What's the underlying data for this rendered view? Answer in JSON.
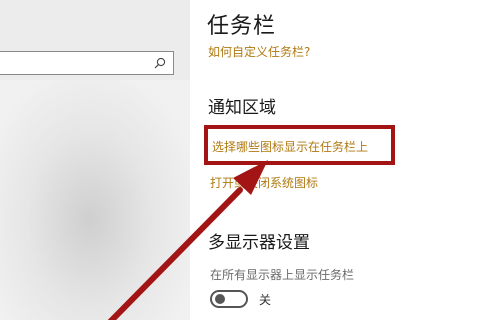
{
  "window": {
    "page_title": "任务栏"
  },
  "sidebar": {
    "search": {
      "placeholder": "",
      "icon": "search-icon"
    }
  },
  "main": {
    "help_link": "如何自定义任务栏?",
    "notification_area": {
      "title": "通知区域",
      "select_icons_link": "选择哪些图标显示在任务栏上",
      "system_icons_link": "打开或关闭系统图标"
    },
    "multi_display": {
      "title": "多显示器设置",
      "show_taskbar_label": "在所有显示器上显示任务栏",
      "toggle_state": "关",
      "toggle_on": false
    }
  },
  "colors": {
    "link": "#b07a12",
    "highlight": "#a31515",
    "arrow": "#a31515"
  }
}
